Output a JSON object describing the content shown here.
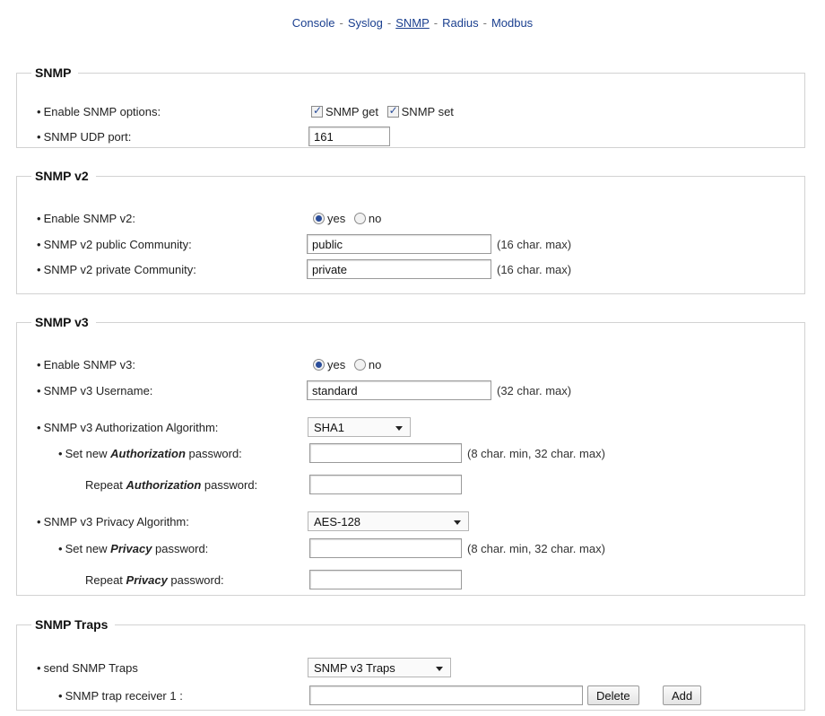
{
  "nav": {
    "items": [
      "Console",
      "Syslog",
      "SNMP",
      "Radius",
      "Modbus"
    ],
    "separator": "-",
    "active": "SNMP"
  },
  "bullet": "•",
  "snmp": {
    "legend": "SNMP",
    "enable_label": "Enable SNMP options:",
    "get_label": "SNMP get",
    "set_label": "SNMP set",
    "port_label": "SNMP UDP port:",
    "port_value": "161"
  },
  "v2": {
    "legend": "SNMP v2",
    "enable_label": "Enable SNMP v2:",
    "yes": "yes",
    "no": "no",
    "public_label": "SNMP v2 public Community:",
    "public_value": "public",
    "public_hint": "(16 char. max)",
    "private_label": "SNMP v2 private Community:",
    "private_value": "private",
    "private_hint": "(16 char. max)"
  },
  "v3": {
    "legend": "SNMP v3",
    "enable_label": "Enable SNMP v3:",
    "yes": "yes",
    "no": "no",
    "username_label": "SNMP v3 Username:",
    "username_value": "standard",
    "username_hint": "(32 char. max)",
    "auth_algo_label": "SNMP v3 Authorization Algorithm:",
    "auth_algo_value": "SHA1",
    "auth_new_pre": "Set new ",
    "auth_new_em": "Authorization",
    "auth_new_post": " password:",
    "auth_hint": "(8 char. min, 32 char. max)",
    "auth_rep_pre": "Repeat ",
    "auth_rep_em": "Authorization",
    "auth_rep_post": " password:",
    "priv_algo_label": "SNMP v3 Privacy Algorithm:",
    "priv_algo_value": "AES-128",
    "priv_new_pre": "Set new ",
    "priv_new_em": "Privacy",
    "priv_new_post": " password:",
    "priv_hint": "(8 char. min, 32 char. max)",
    "priv_rep_pre": "Repeat ",
    "priv_rep_em": "Privacy",
    "priv_rep_post": " password:"
  },
  "traps": {
    "legend": "SNMP Traps",
    "send_label": "send SNMP Traps",
    "send_value": "SNMP v3 Traps",
    "receiver_label": "SNMP trap receiver 1 :",
    "receiver_value": "",
    "delete_label": "Delete",
    "add_label": "Add"
  }
}
